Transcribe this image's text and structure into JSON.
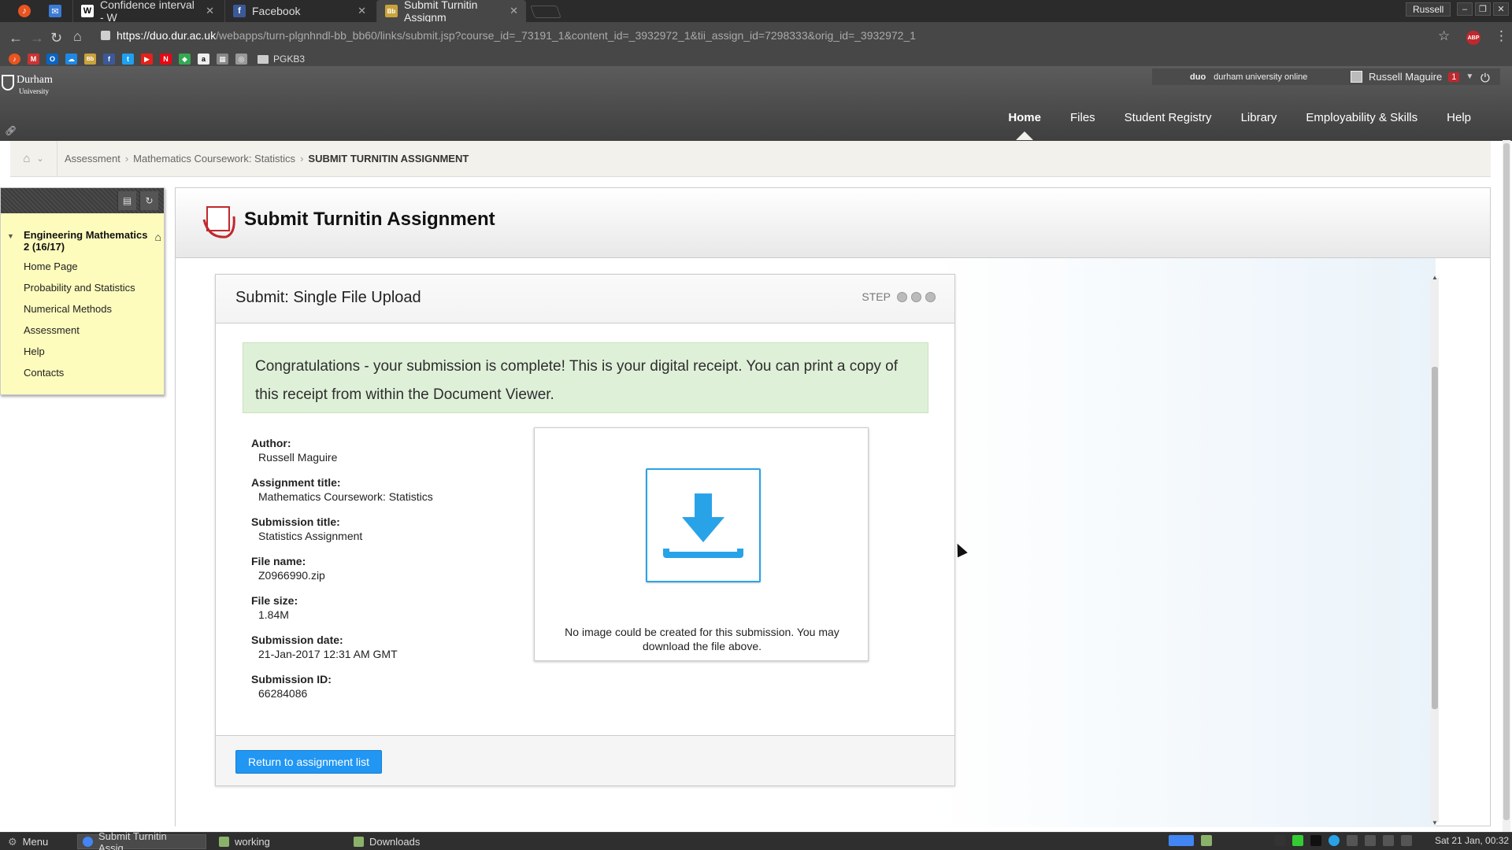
{
  "browser": {
    "tabs": [
      {
        "title": "Confidence interval - W",
        "icon": "wikipedia-icon"
      },
      {
        "title": "Facebook",
        "icon": "facebook-icon"
      },
      {
        "title": "Submit Turnitin Assignm",
        "icon": "blackboard-icon",
        "active": true
      }
    ],
    "profile": "Russell",
    "url_host": "https://duo.dur.ac.uk",
    "url_path": "/webapps/turn-plgnhndl-bb_bb60/links/submit.jsp?course_id=_73191_1&content_id=_3932972_1&tii_assign_id=7298333&orig_id=_3932972_1",
    "bookmark_folder": "PGKB3"
  },
  "header": {
    "logo_name": "Durham",
    "logo_sub": "University",
    "duo_brand": "duo",
    "duo_tagline": "durham university online",
    "user_name": "Russell Maguire",
    "notification_count": "1",
    "nav": [
      "Home",
      "Files",
      "Student Registry",
      "Library",
      "Employability & Skills",
      "Help"
    ]
  },
  "breadcrumb": {
    "items": [
      "Assessment",
      "Mathematics Coursework: Statistics"
    ],
    "current": "SUBMIT TURNITIN ASSIGNMENT"
  },
  "course_menu": {
    "title": "Engineering Mathematics 2 (16/17)",
    "items": [
      "Home Page",
      "Probability and Statistics",
      "Numerical Methods",
      "Assessment",
      "Help",
      "Contacts"
    ]
  },
  "page": {
    "title": "Submit Turnitin Assignment",
    "panel_title": "Submit: Single File Upload",
    "step_label": "STEP",
    "success_message": "Congratulations - your submission is complete! This is your digital receipt. You can print a copy of this receipt from within the Document Viewer.",
    "details": [
      {
        "label": "Author:",
        "value": "Russell Maguire"
      },
      {
        "label": "Assignment title:",
        "value": "Mathematics Coursework: Statistics"
      },
      {
        "label": "Submission title:",
        "value": "Statistics Assignment"
      },
      {
        "label": "File name:",
        "value": "Z0966990.zip"
      },
      {
        "label": "File size:",
        "value": "1.84M"
      },
      {
        "label": "Submission date:",
        "value": "21-Jan-2017 12:31 AM GMT"
      },
      {
        "label": "Submission ID:",
        "value": "66284086"
      }
    ],
    "preview_note": "No image could be created for this submission. You may download the file above.",
    "return_button": "Return to assignment list"
  },
  "taskbar": {
    "menu": "Menu",
    "items": [
      "Submit Turnitin Assig...",
      "working",
      "Downloads"
    ],
    "clock": "Sat 21 Jan, 00:32"
  },
  "colors": {
    "accent": "#2196f3",
    "success_bg": "#dff0d8",
    "course_menu_bg": "#fdfcbd",
    "header_bg": "#4a4a4a"
  }
}
